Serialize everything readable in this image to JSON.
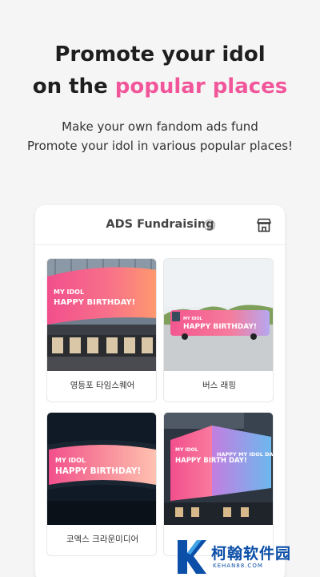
{
  "hero": {
    "line1": "Promote your idol",
    "line2_prefix": "on the ",
    "line2_accent": "popular places",
    "sub1": "Make your own fandom ads fund",
    "sub2": "Promote your idol in various popular places!"
  },
  "card": {
    "title": "ADS Fundraising",
    "info_icon": "i",
    "store_icon": "store-icon"
  },
  "tiles": [
    {
      "label": "영등포 타임스퀘어",
      "banner_top": "MY IDOL",
      "banner_main": "HAPPY BIRTHDAY!"
    },
    {
      "label": "버스 래핑",
      "banner_top": "MY IDOL",
      "banner_main": "HAPPY BIRTHDAY!"
    },
    {
      "label": "코엑스 크라운미디어",
      "banner_top": "MY IDOL",
      "banner_main": "HAPPY BIRTHDAY!"
    },
    {
      "label": "",
      "banner_top": "MY IDOL",
      "banner_main": "HAPPY BIRTH DAY!",
      "banner_side": "HAPPY MY IDOL DAY"
    }
  ],
  "watermark": {
    "text": "柯翰软件园",
    "sub": "KEHAN88.COM"
  },
  "colors": {
    "accent": "#f2569a",
    "watermark": "#0b4fa8"
  }
}
